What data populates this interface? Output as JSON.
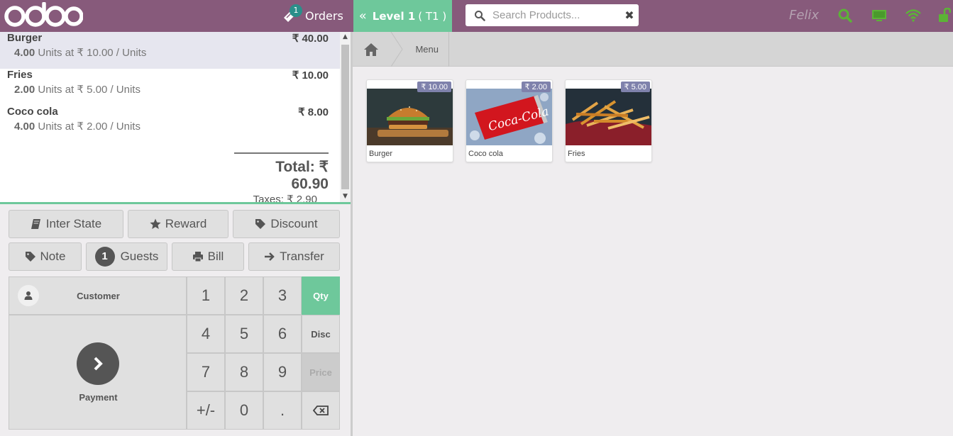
{
  "header": {
    "logo_text": "odoo",
    "orders_label": "Orders",
    "orders_count": "1",
    "level_label": "Level 1",
    "table_label": "( T1 )",
    "search_placeholder": "Search Products...",
    "user_name": "Felix",
    "colors": {
      "bar": "#875a7b",
      "accent": "#6ec89b",
      "status": "#5cb337"
    }
  },
  "order": {
    "lines": [
      {
        "name": "Burger",
        "price": "₹ 40.00",
        "qty": "4.00",
        "info": " Units at ₹ 10.00 / Units"
      },
      {
        "name": "Fries",
        "price": "₹ 10.00",
        "qty": "2.00",
        "info": " Units at ₹ 5.00 / Units"
      },
      {
        "name": "Coco cola",
        "price": "₹ 8.00",
        "qty": "4.00",
        "info": " Units at ₹ 2.00 / Units"
      }
    ],
    "total": "Total: ₹ 60.90",
    "taxes": "Taxes: ₹ 2.90"
  },
  "controls": {
    "inter_state": "Inter State",
    "reward": "Reward",
    "discount": "Discount",
    "note": "Note",
    "guests_count": "1",
    "guests": "Guests",
    "bill": "Bill",
    "transfer": "Transfer"
  },
  "numpad": {
    "customer": "Customer",
    "payment": "Payment",
    "keys": [
      "1",
      "2",
      "3",
      "4",
      "5",
      "6",
      "7",
      "8",
      "9",
      "+/-",
      "0",
      "."
    ],
    "modes": [
      "Qty",
      "Disc",
      "Price"
    ]
  },
  "breadcrumb": {
    "menu": "Menu"
  },
  "products": [
    {
      "name": "Burger",
      "price": "₹ 10.00"
    },
    {
      "name": "Coco cola",
      "price": "₹ 2.00"
    },
    {
      "name": "Fries",
      "price": "₹ 5.00"
    }
  ]
}
